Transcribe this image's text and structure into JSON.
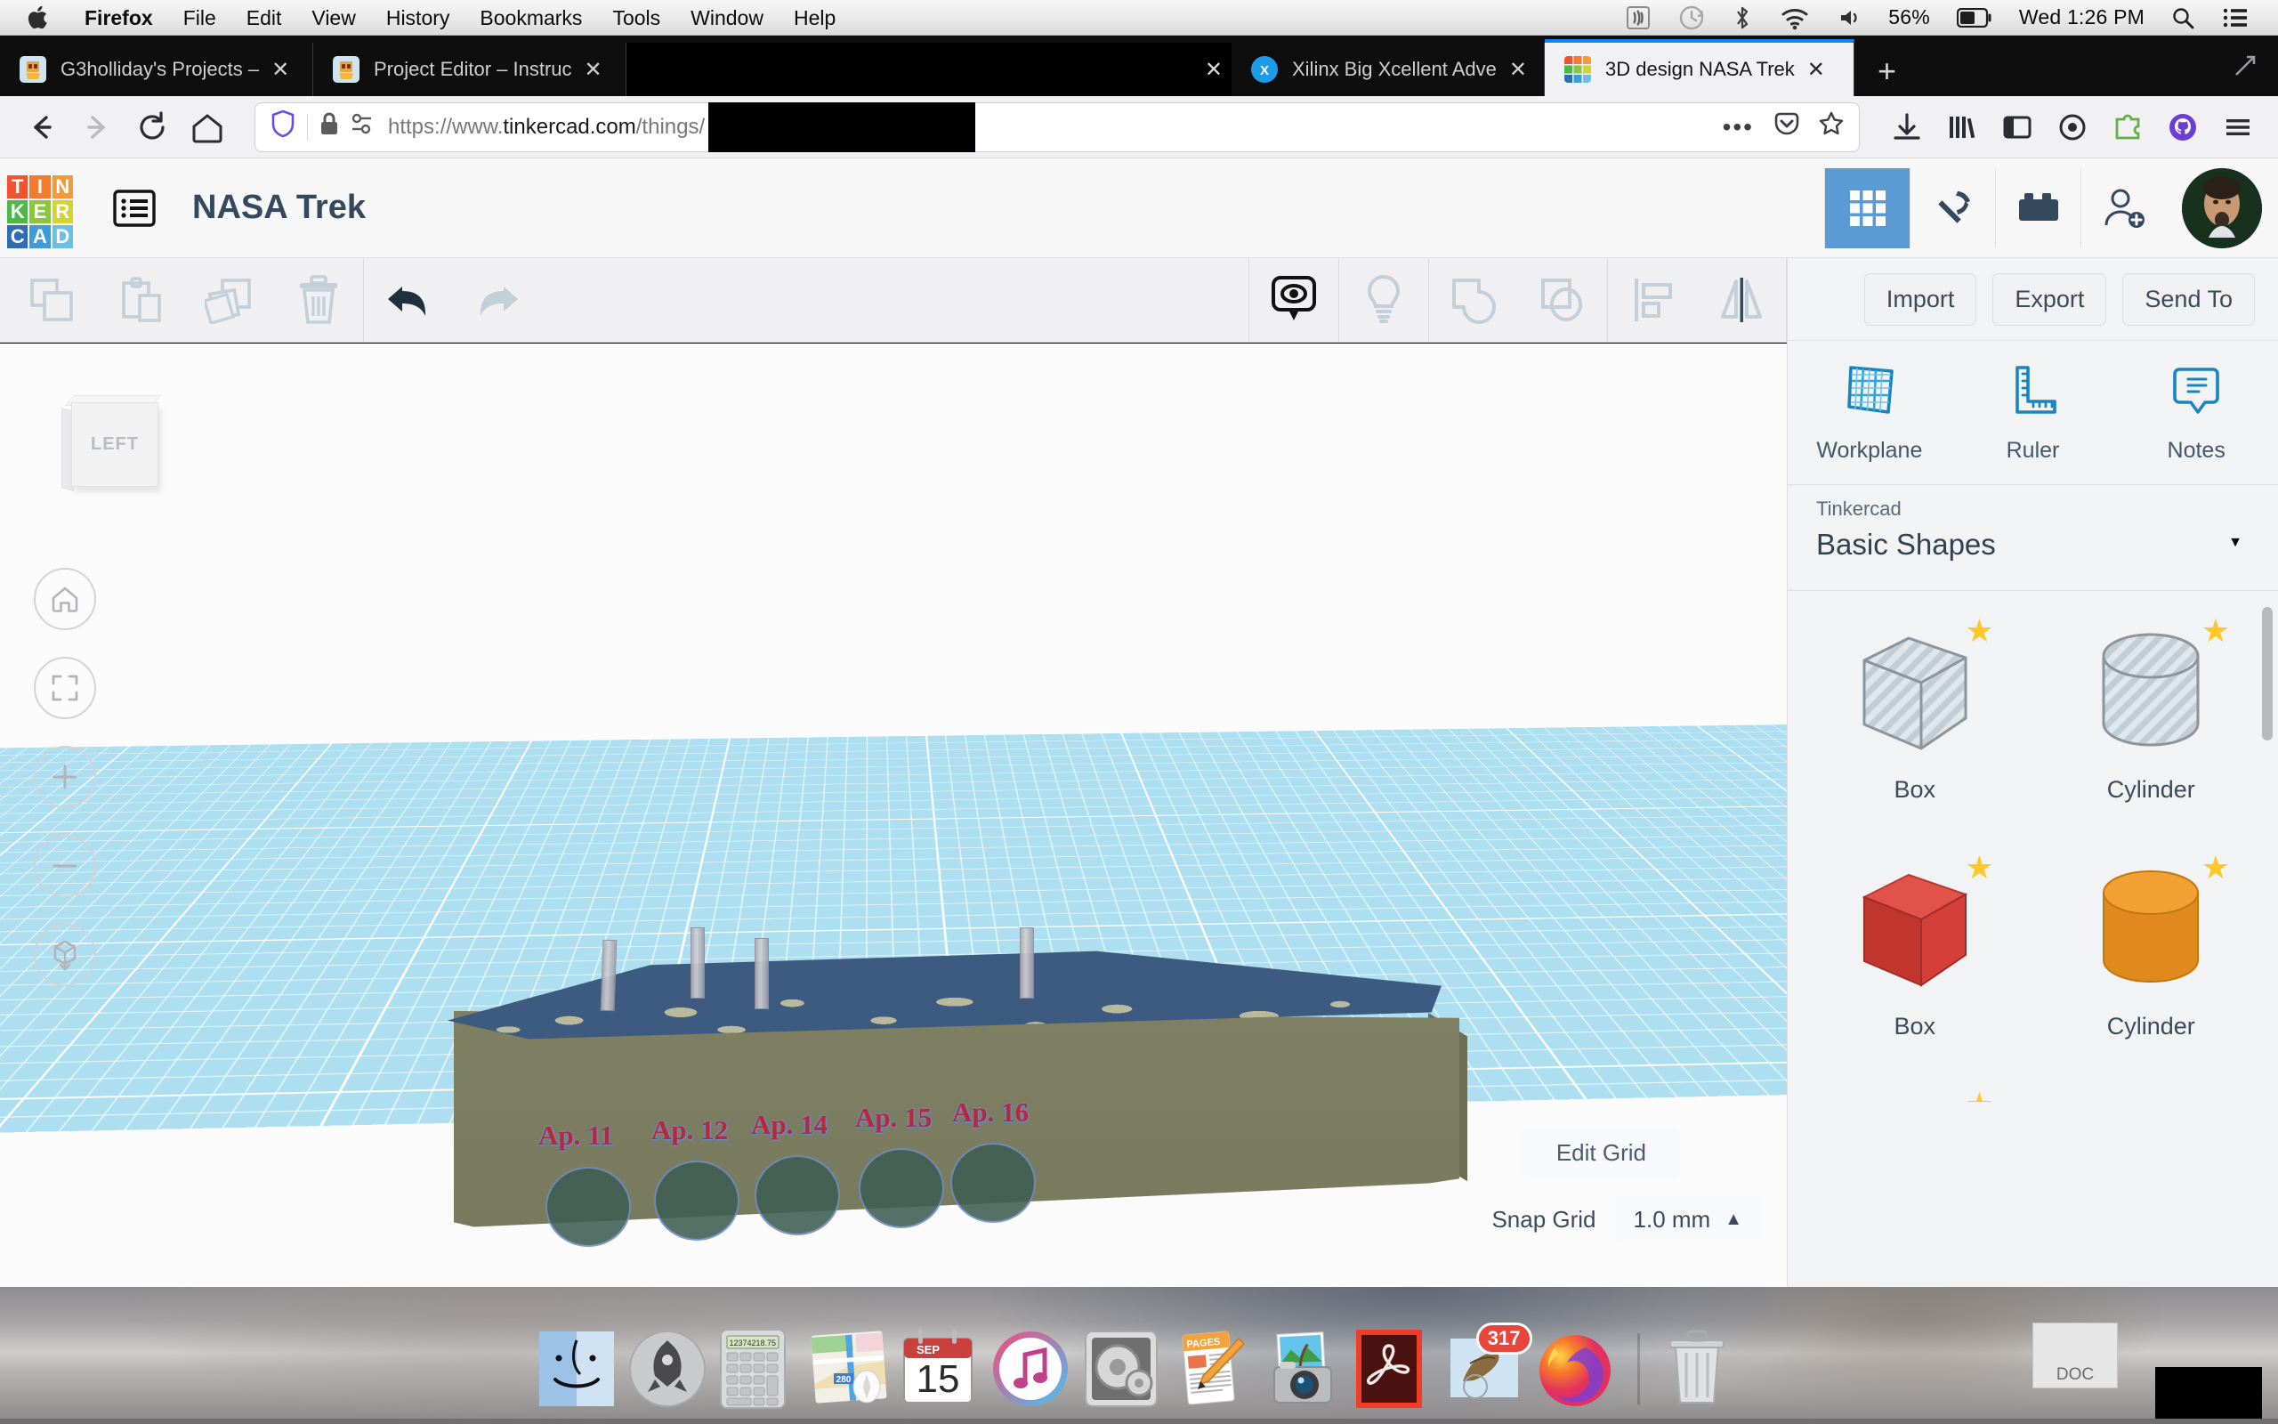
{
  "menubar": {
    "apple_icon": "apple-logo-icon",
    "items": [
      {
        "label": "Firefox",
        "bold": true
      },
      {
        "label": "File",
        "bold": false
      },
      {
        "label": "Edit",
        "bold": false
      },
      {
        "label": "View",
        "bold": false
      },
      {
        "label": "History",
        "bold": false
      },
      {
        "label": "Bookmarks",
        "bold": false
      },
      {
        "label": "Tools",
        "bold": false
      },
      {
        "label": "Window",
        "bold": false
      },
      {
        "label": "Help",
        "bold": false
      }
    ],
    "status": {
      "airplay_icon": "airplay-icon",
      "timemachine_icon": "time-machine-icon",
      "bluetooth_icon": "bluetooth-icon",
      "wifi_icon": "wifi-icon",
      "volume_icon": "volume-icon",
      "battery_percent": "56%",
      "battery_icon": "battery-icon",
      "clock": "Wed 1:26 PM",
      "search_icon": "spotlight-search-icon",
      "notifications_icon": "notification-center-icon"
    }
  },
  "browser": {
    "tabs": [
      {
        "title": "G3holliday's Projects –",
        "favicon": "tinkercad-robot-favicon",
        "active": false,
        "redacted": false
      },
      {
        "title": "Project Editor – Instruc",
        "favicon": "tinkercad-robot-favicon",
        "active": false,
        "redacted": false
      },
      {
        "title": "",
        "favicon": "",
        "active": false,
        "redacted": true
      },
      {
        "title": "Xilinx Big Xcellent Adve",
        "favicon": "xilinx-favicon",
        "active": false,
        "redacted": false
      },
      {
        "title": "3D design NASA Trek",
        "favicon": "tinkercad-favicon",
        "active": true,
        "redacted": false
      }
    ],
    "close_label": "✕",
    "newtab_label": "+",
    "nav": {
      "back_icon": "back-arrow-icon",
      "forward_icon": "forward-arrow-icon",
      "reload_icon": "reload-icon",
      "home_icon": "home-icon",
      "shield_icon": "tracking-protection-shield-icon",
      "lock_icon": "padlock-icon",
      "permissions_icon": "site-permissions-icon",
      "url_prefix": "https://www.",
      "url_domain": "tinkercad.com",
      "url_path": "/things/",
      "page_actions_icon": "ellipsis-icon",
      "pocket_icon": "pocket-icon",
      "bookmark_star_icon": "star-icon",
      "downloads_icon": "downloads-icon",
      "library_icon": "library-icon",
      "sidebar_icon": "sidebar-icon",
      "container_icon": "container-tabs-icon",
      "addon_icon": "addon-puzzle-icon",
      "github_icon": "github-icon",
      "menu_icon": "hamburger-menu-icon"
    }
  },
  "tinkercad": {
    "logo_tiles": [
      {
        "letter": "T",
        "color": "#f2522e"
      },
      {
        "letter": "I",
        "color": "#f47a2c"
      },
      {
        "letter": "N",
        "color": "#f79a33"
      },
      {
        "letter": "K",
        "color": "#4cb848"
      },
      {
        "letter": "E",
        "color": "#8cc63e"
      },
      {
        "letter": "R",
        "color": "#d4d430"
      },
      {
        "letter": "C",
        "color": "#2e6db4"
      },
      {
        "letter": "A",
        "color": "#3d9bd9"
      },
      {
        "letter": "D",
        "color": "#68c0e8"
      }
    ],
    "list_icon": "project-list-icon",
    "project_title": "NASA Trek",
    "header_buttons": [
      {
        "name": "grid-view-button",
        "icon": "nine-square-grid-icon",
        "active": true
      },
      {
        "name": "blocks-code-button",
        "icon": "pickaxe-icon",
        "active": false
      },
      {
        "name": "bricks-button",
        "icon": "lego-brick-icon",
        "active": false
      },
      {
        "name": "invite-people-button",
        "icon": "person-add-icon",
        "active": false
      }
    ],
    "avatar_name": "user-avatar",
    "toolbar": [
      {
        "name": "copy-button",
        "icon": "copy-icon",
        "state": "disabled"
      },
      {
        "name": "paste-button",
        "icon": "paste-clipboard-icon",
        "state": "disabled"
      },
      {
        "name": "duplicate-button",
        "icon": "duplicate-icon",
        "state": "disabled"
      },
      {
        "name": "delete-button",
        "icon": "trash-icon",
        "state": "disabled"
      },
      {
        "name": "undo-button",
        "icon": "undo-arrow-icon",
        "state": "enabled"
      },
      {
        "name": "redo-button",
        "icon": "redo-arrow-icon",
        "state": "disabled"
      },
      {
        "name": "show-hide-button",
        "icon": "eye-in-speech-bubble-icon",
        "state": "enabled"
      },
      {
        "name": "light-button",
        "icon": "lightbulb-icon",
        "state": "disabled"
      },
      {
        "name": "group-button",
        "icon": "group-shapes-icon",
        "state": "disabled"
      },
      {
        "name": "ungroup-button",
        "icon": "ungroup-shapes-icon",
        "state": "disabled"
      },
      {
        "name": "align-button",
        "icon": "align-icon",
        "state": "disabled"
      },
      {
        "name": "mirror-button",
        "icon": "mirror-flip-icon",
        "state": "disabled"
      }
    ],
    "viewcube_label": "LEFT",
    "view_nav": [
      {
        "name": "home-view-button",
        "icon": "home-icon"
      },
      {
        "name": "fit-to-view-button",
        "icon": "fit-frame-icon"
      },
      {
        "name": "zoom-in-button",
        "icon": "plus-icon"
      },
      {
        "name": "zoom-out-button",
        "icon": "minus-icon"
      },
      {
        "name": "orthographic-toggle-button",
        "icon": "cube-perspective-icon"
      }
    ],
    "canvas": {
      "crater_labels": [
        "Ap. 11",
        "Ap. 12",
        "Ap. 14",
        "Ap. 15",
        "Ap. 16"
      ],
      "edit_grid_label": "Edit Grid",
      "snap_grid_label": "Snap Grid",
      "snap_grid_value": "1.0 mm",
      "snap_grid_caret": "▲",
      "panel_handle_icon": "chevron-right-icon"
    },
    "sidebar": {
      "actions": [
        {
          "name": "import-button",
          "label": "Import"
        },
        {
          "name": "export-button",
          "label": "Export"
        },
        {
          "name": "send-to-button",
          "label": "Send To"
        }
      ],
      "tools": [
        {
          "name": "workplane-tool",
          "label": "Workplane",
          "icon": "workplane-grid-icon"
        },
        {
          "name": "ruler-tool",
          "label": "Ruler",
          "icon": "ruler-icon"
        },
        {
          "name": "notes-tool",
          "label": "Notes",
          "icon": "note-bubble-icon"
        }
      ],
      "library_owner": "Tinkercad",
      "library_name": "Basic Shapes",
      "library_caret": "▼",
      "shapes": [
        {
          "name": "Box",
          "variant": "hole",
          "starred": true
        },
        {
          "name": "Cylinder",
          "variant": "hole",
          "starred": true
        },
        {
          "name": "Box",
          "variant": "solid-red",
          "starred": true
        },
        {
          "name": "Cylinder",
          "variant": "solid-orange",
          "starred": true
        },
        {
          "name": "",
          "variant": "sphere-blue",
          "starred": true
        },
        {
          "name": "",
          "variant": "hand",
          "starred": false
        }
      ]
    }
  },
  "dock": {
    "items": [
      {
        "name": "finder",
        "icon": "finder-icon",
        "badge": null
      },
      {
        "name": "launchpad",
        "icon": "launchpad-rocket-icon",
        "badge": null
      },
      {
        "name": "calculator",
        "icon": "calculator-icon",
        "badge": null
      },
      {
        "name": "maps",
        "icon": "maps-icon",
        "badge": null
      },
      {
        "name": "calendar",
        "icon": "calendar-icon",
        "badge": null
      },
      {
        "name": "itunes",
        "icon": "itunes-music-note-icon",
        "badge": null
      },
      {
        "name": "system-preferences",
        "icon": "gears-icon",
        "badge": null
      },
      {
        "name": "pages",
        "icon": "pages-document-icon",
        "badge": null
      },
      {
        "name": "photo-booth",
        "icon": "photo-booth-camera-icon",
        "badge": null
      },
      {
        "name": "acrobat-reader",
        "icon": "acrobat-a-icon",
        "badge": null
      },
      {
        "name": "mail",
        "icon": "mail-stamp-icon",
        "badge": "317"
      },
      {
        "name": "firefox",
        "icon": "firefox-icon",
        "badge": null
      }
    ],
    "calculator_display": "12374218.75",
    "calendar_month": "SEP",
    "calendar_day": "15",
    "maps_route": "280",
    "pages_label": "PAGES",
    "doc_thumb_label": "DOC",
    "trash_name": "trash-icon"
  }
}
